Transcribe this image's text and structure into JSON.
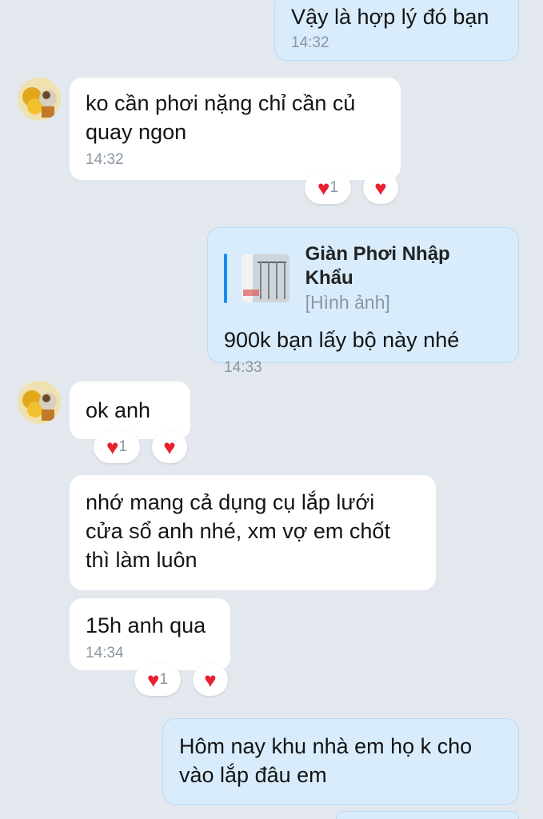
{
  "messages": [
    {
      "text": "Vậy là hợp lý đó bạn",
      "time": "14:32"
    },
    {
      "text_l1": "ko cần phơi nặng chỉ cần củ",
      "text_l2": "quay ngon",
      "time": "14:32",
      "reaction_count": "1"
    },
    {
      "quote_title": "Giàn Phơi Nhập Khẩu",
      "quote_sub": "[Hình ảnh]",
      "text": "900k bạn lấy bộ này nhé",
      "time": "14:33"
    },
    {
      "text": "ok anh",
      "reaction_count": "1"
    },
    {
      "text_l1": "nhớ mang cả dụng cụ lắp lưới",
      "text_l2": "cửa sổ anh nhé, xm vợ em chốt",
      "text_l3": "thì làm luôn"
    },
    {
      "text": "15h anh qua",
      "time": "14:34",
      "reaction_count": "1"
    },
    {
      "text_l1": "Hôm nay khu nhà em họ k cho",
      "text_l2": "vào lắp đâu em"
    }
  ],
  "icons": {
    "reaction": "heart-icon",
    "avatar": "contact-avatar"
  },
  "colors": {
    "incoming": "#ffffff",
    "outgoing": "#d8ecfc",
    "background": "#e3e8ef",
    "heart": "#e8202f"
  }
}
